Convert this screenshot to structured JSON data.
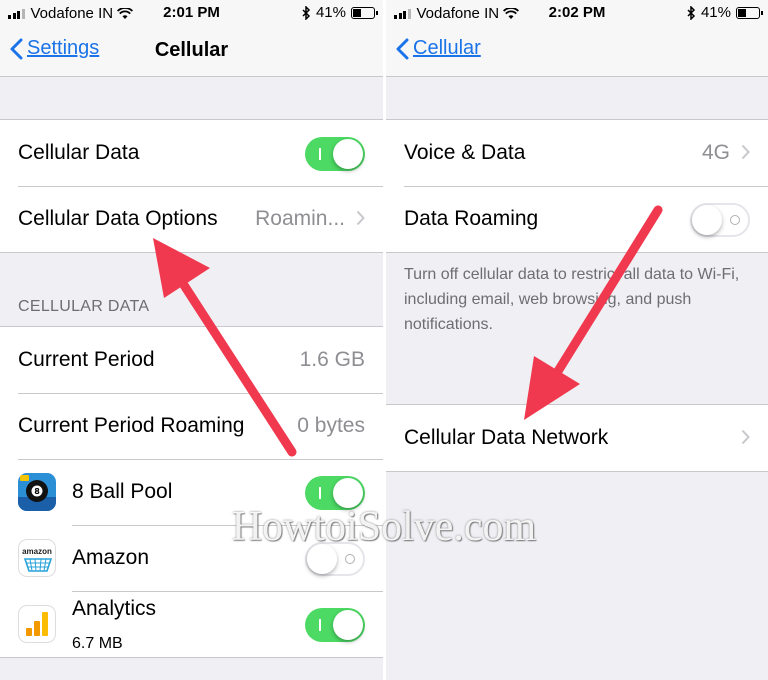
{
  "left": {
    "status": {
      "carrier": "Vodafone IN",
      "time": "2:01 PM",
      "battery": "41%"
    },
    "nav": {
      "back_label": "Settings",
      "title": "Cellular"
    },
    "rows": {
      "cellular_data": {
        "label": "Cellular Data",
        "toggle": "on"
      },
      "cellular_data_options": {
        "label": "Cellular Data Options",
        "value": "Roamin..."
      }
    },
    "section_header": "CELLULAR DATA",
    "usage": [
      {
        "label": "Current Period",
        "value": "1.6 GB"
      },
      {
        "label": "Current Period Roaming",
        "value": "0 bytes"
      }
    ],
    "apps": [
      {
        "name": "8 Ball Pool",
        "toggle": "on",
        "icon": "8-ball-pool-icon"
      },
      {
        "name": "Amazon",
        "toggle": "off",
        "icon": "amazon-icon",
        "icon_text": "amazon"
      },
      {
        "name": "Analytics",
        "detail": "6.7 MB",
        "toggle": "on",
        "icon": "analytics-icon"
      }
    ]
  },
  "right": {
    "status": {
      "carrier": "Vodafone IN",
      "time": "2:02 PM",
      "battery": "41%"
    },
    "nav": {
      "back_label": "Cellular"
    },
    "rows": {
      "voice_data": {
        "label": "Voice & Data",
        "value": "4G"
      },
      "data_roaming": {
        "label": "Data Roaming",
        "toggle": "off"
      }
    },
    "roaming_footer": "Turn off cellular data to restrict all data to Wi-Fi, including email, web browsing, and push notifications.",
    "network": {
      "label": "Cellular Data Network"
    }
  },
  "watermark": "HowtoiSolve.com",
  "colors": {
    "accent": "#1a73e8",
    "toggle_on": "#4cd964",
    "arrow": "#f0394e",
    "background": "#efeff4"
  }
}
